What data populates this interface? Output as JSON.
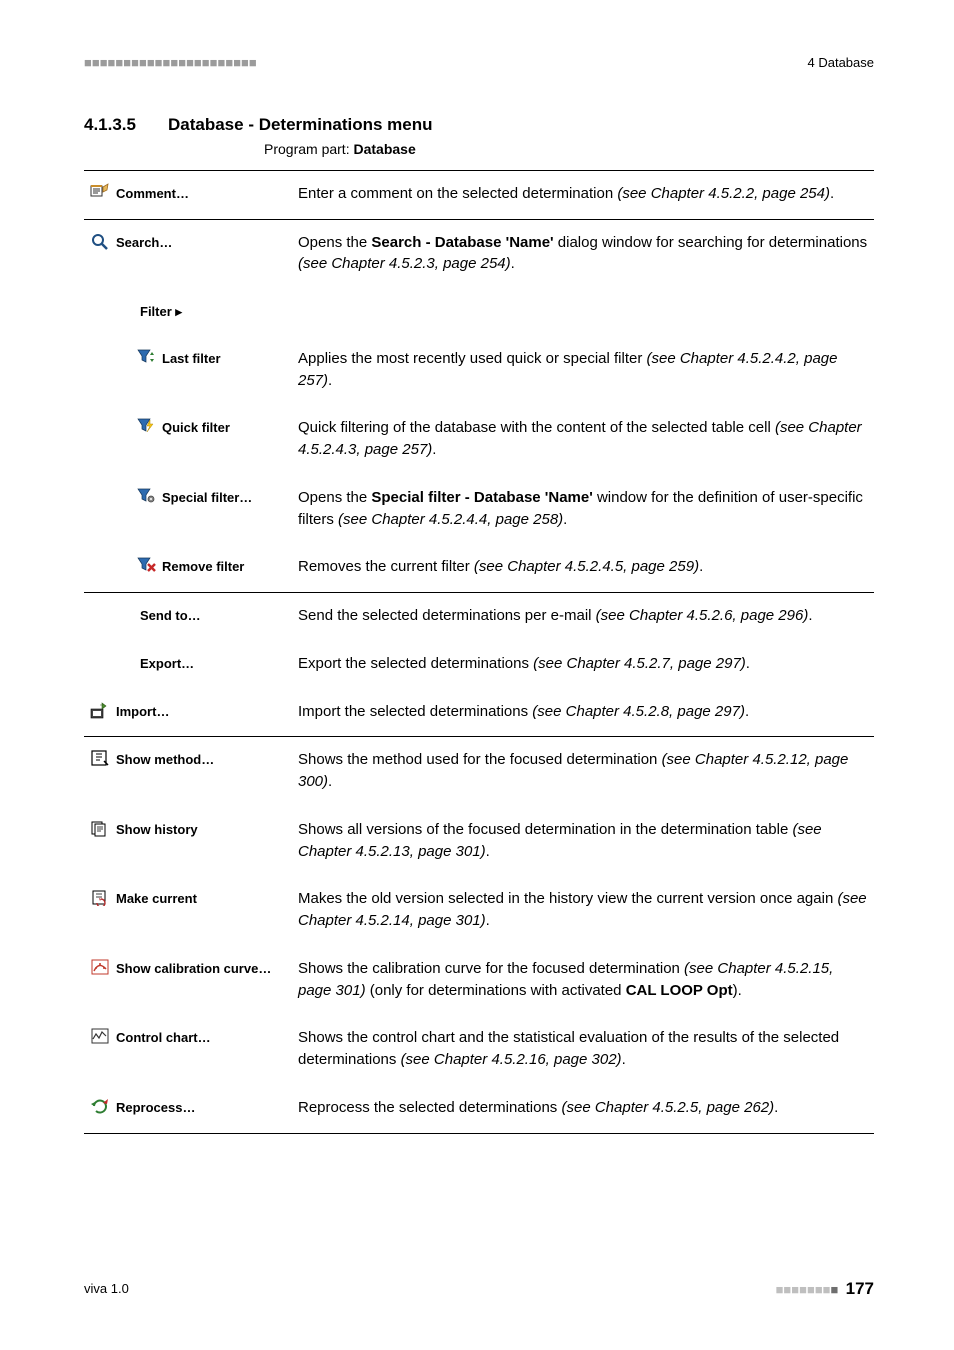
{
  "header": {
    "chapter": "4 Database"
  },
  "section": {
    "number": "4.1.3.5",
    "title": "Database - Determinations menu",
    "program_part_prefix": "Program part: ",
    "program_part": "Database"
  },
  "items": [
    {
      "key": "comment",
      "icon": "comment",
      "indent": 0,
      "label": "Comment…",
      "desc": "Enter a comment on the selected determination <i>(see Chapter 4.5.2.2, page 254)</i>."
    },
    {
      "key": "search",
      "icon": "search",
      "indent": 0,
      "label": "Search…",
      "desc": "Opens the <b>Search - Database 'Name'</b> dialog window for searching for determinations <i>(see Chapter 4.5.2.3, page 254)</i>."
    },
    {
      "key": "filter",
      "icon": "",
      "indent": 1,
      "label": "Filter ▸",
      "desc": "",
      "noborder": true
    },
    {
      "key": "lastfilter",
      "icon": "funnel-arrow",
      "indent": 2,
      "label": "Last filter",
      "desc": "Applies the most recently used quick or special filter <i>(see Chapter 4.5.2.4.2, page 257)</i>.",
      "noborder": true
    },
    {
      "key": "quickfilter",
      "icon": "funnel-lightning",
      "indent": 2,
      "label": "Quick filter",
      "desc": "Quick filtering of the database with the content of the selected table cell <i>(see Chapter 4.5.2.4.3, page 257)</i>.",
      "noborder": true
    },
    {
      "key": "specialfilter",
      "icon": "funnel-gear",
      "indent": 2,
      "label": "Special filter…",
      "desc": "Opens the <b>Special filter - Database 'Name'</b> window for the definition of user-specific filters <i>(see Chapter 4.5.2.4.4, page 258)</i>.",
      "noborder": true
    },
    {
      "key": "removefilter",
      "icon": "funnel-x",
      "indent": 2,
      "label": "Remove filter",
      "desc": "Removes the current filter <i>(see Chapter 4.5.2.4.5, page 259)</i>.",
      "noborder": true
    },
    {
      "key": "sendto",
      "icon": "",
      "indent": 1,
      "label": "Send to…",
      "desc": "Send the selected determinations per e-mail <i>(see Chapter 4.5.2.6, page 296)</i>."
    },
    {
      "key": "export",
      "icon": "",
      "indent": 1,
      "label": "Export…",
      "desc": "Export the selected determinations <i>(see Chapter 4.5.2.7, page 297)</i>.",
      "noborder": true
    },
    {
      "key": "import",
      "icon": "import",
      "indent": 0,
      "label": "Import…",
      "desc": "Import the selected determinations <i>(see Chapter 4.5.2.8, page 297)</i>.",
      "noborder": true
    },
    {
      "key": "showmethod",
      "icon": "method",
      "indent": 0,
      "label": "Show method…",
      "desc": "Shows the method used for the focused determination <i>(see Chapter 4.5.2.12, page 300)</i>."
    },
    {
      "key": "showhistory",
      "icon": "history",
      "indent": 0,
      "label": "Show history",
      "desc": "Shows all versions of the focused determination in the determination table <i>(see Chapter 4.5.2.13, page 301)</i>.",
      "noborder": true
    },
    {
      "key": "makecurrent",
      "icon": "makecurrent",
      "indent": 0,
      "label": "Make current",
      "desc": "Makes the old version selected in the history view the current version once again <i>(see Chapter 4.5.2.14, page 301)</i>.",
      "noborder": true
    },
    {
      "key": "showcal",
      "icon": "calcurve",
      "indent": 0,
      "label": "Show calibration curve…",
      "desc": "Shows the calibration curve for the focused determination <i>(see Chapter 4.5.2.15, page 301)</i> (only for determinations with activated <b>CAL LOOP Opt</b>).",
      "noborder": true
    },
    {
      "key": "controlchart",
      "icon": "controlchart",
      "indent": 0,
      "label": "Control chart…",
      "desc": "Shows the control chart and the statistical evaluation of the results of the selected determinations <i>(see Chapter 4.5.2.16, page 302)</i>.",
      "noborder": true
    },
    {
      "key": "reprocess",
      "icon": "reprocess",
      "indent": 0,
      "label": "Reprocess…",
      "desc": "Reprocess the selected determinations <i>(see Chapter 4.5.2.5, page 262)</i>.",
      "noborder": true
    }
  ],
  "footer": {
    "left": "viva 1.0",
    "page": "177"
  }
}
